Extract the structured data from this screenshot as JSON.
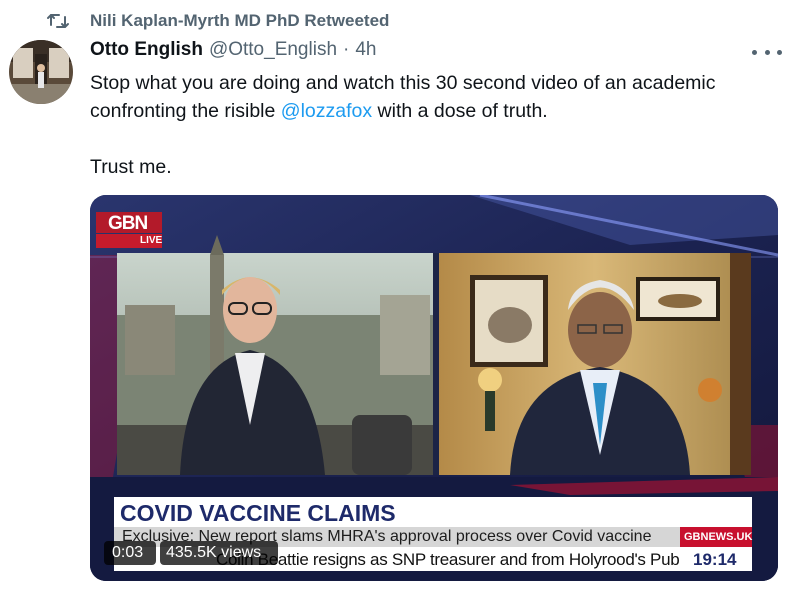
{
  "retweet": {
    "label": "Nili Kaplan-Myrth MD PhD Retweeted",
    "icon": "retweet-icon"
  },
  "author": {
    "name": "Otto English",
    "handle": "@Otto_English",
    "separator": "·",
    "time": "4h",
    "avatar_icon": "avatar"
  },
  "tweet": {
    "line1": "Stop what you are doing and watch this 30 second video of an academic",
    "line2_before": "confronting the risible ",
    "mention": "@lozzafox",
    "line2_after": " with a dose of truth.",
    "line3": "Trust me."
  },
  "video": {
    "channel_logo": "GBN",
    "live_label": "LIVE",
    "headline": "COVID VACCINE CLAIMS",
    "subheadline": "Exclusive: New report slams MHRA's approval process over Covid vaccine",
    "source": "GBNEWS.UK",
    "ticker": "Colin Beattie resigns as SNP treasurer and from Holyrood's Public Audit C",
    "clock": "19:14",
    "elapsed": "0:03",
    "views": "435.5K views"
  },
  "colors": {
    "link": "#1d9bf0",
    "secondary_text": "#536471",
    "gb_news_red": "#c8102e",
    "gb_news_navy": "#1e2a6a"
  }
}
